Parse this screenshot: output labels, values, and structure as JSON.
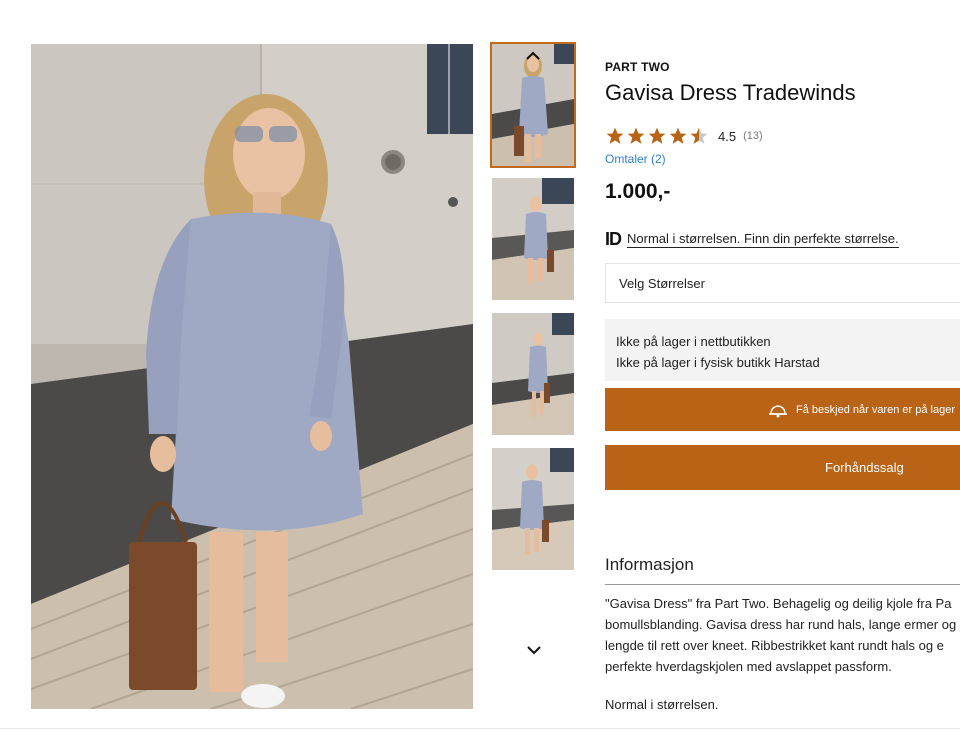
{
  "product": {
    "brand": "PART TWO",
    "title": "Gavisa Dress Tradewinds",
    "rating": {
      "value": "4.5",
      "count": "(13)",
      "stars_filled": 4.5,
      "stars_total": 5,
      "star_color": "#b86316"
    },
    "reviews_link": "Omtaler (2)",
    "price": "1.000,-",
    "size_hint": {
      "icon": "ID",
      "text": "Normal i størrelsen. Finn din perfekte størrelse."
    },
    "size_select": {
      "value": "Velg Størrelser"
    },
    "stock": {
      "online": "Ikke på lager i nettbutikken",
      "store": "Ikke på lager i fysisk butikk Harstad"
    },
    "notify_button": {
      "icon": "bell-icon",
      "label": "Få beskjed når varen er på lager"
    },
    "preorder_button": {
      "label": "Forhåndssalg"
    },
    "accent_color": "#b86316"
  },
  "information": {
    "heading": "Informasjon",
    "lines": [
      "\"Gavisa Dress\" fra Part Two. Behagelig og deilig kjole fra Pa",
      "bomullsblanding. Gavisa dress har rund hals, lange ermer og",
      "lengde til rett over kneet. Ribbestrikket kant rundt hals og e",
      "perfekte hverdagskjolen med avslappet passform."
    ],
    "after": "Normal i størrelsen."
  },
  "gallery": {
    "thumbnail_count": 4,
    "active_index": 0,
    "up_icon": "chevron-up-icon",
    "down_icon": "chevron-down-icon"
  }
}
